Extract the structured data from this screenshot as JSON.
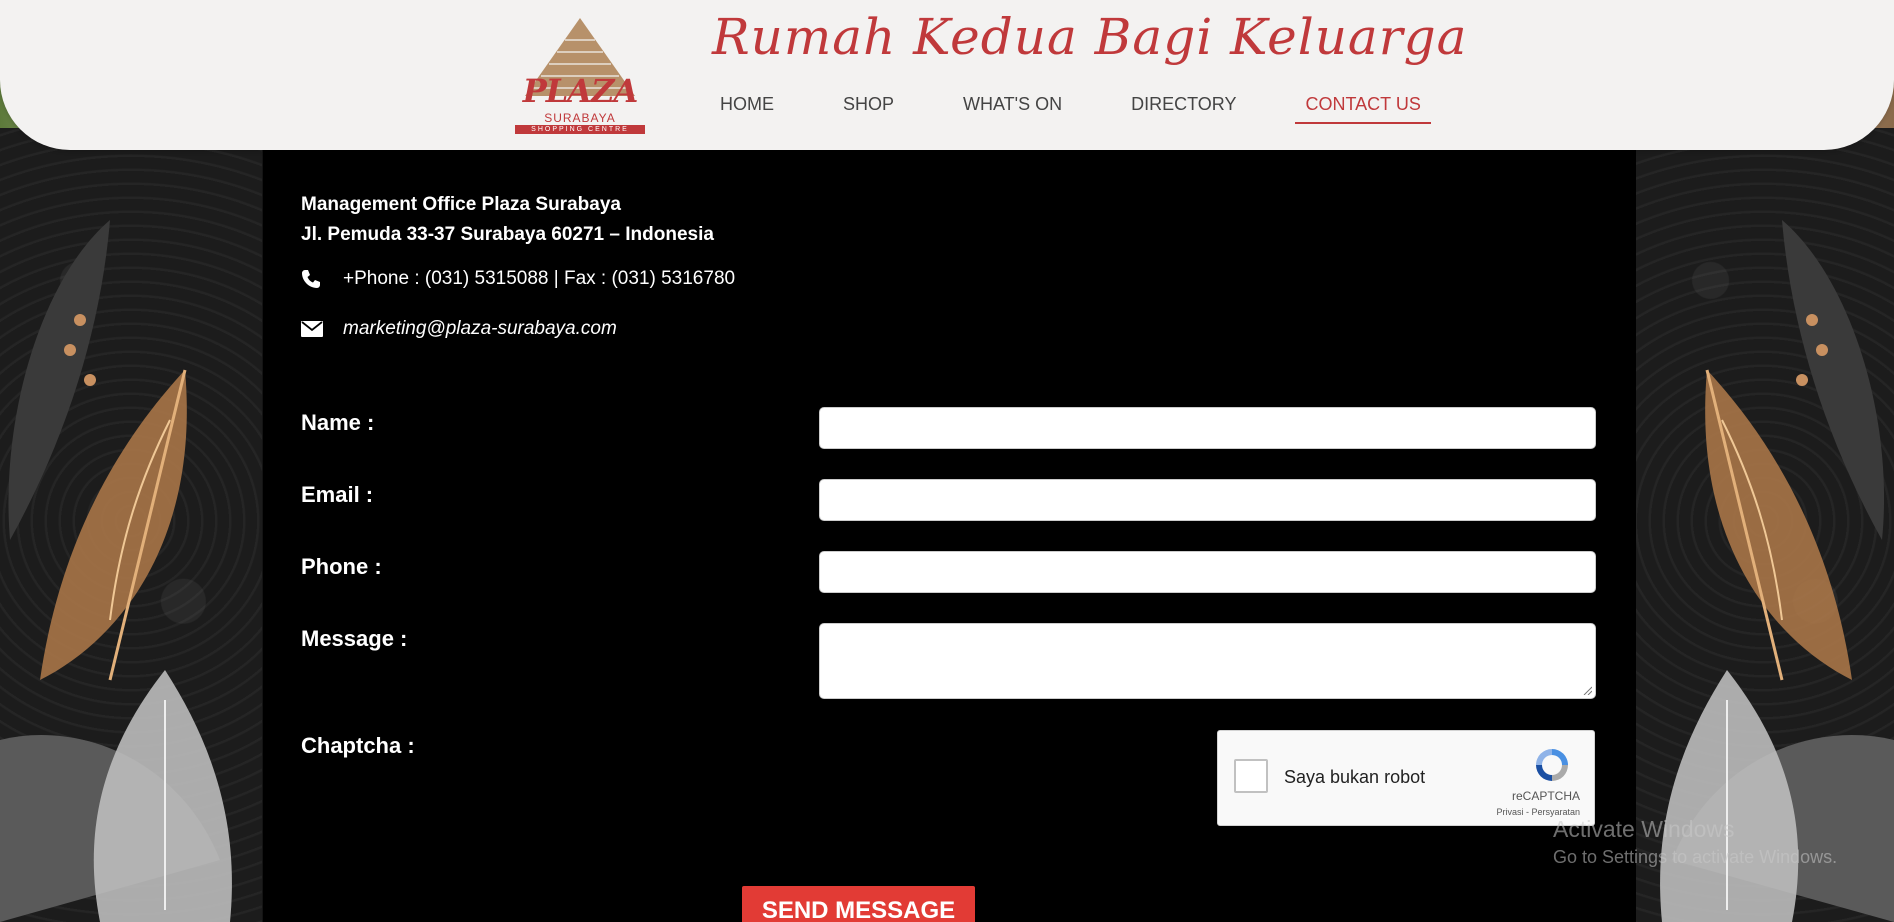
{
  "header": {
    "tagline": "Rumah Kedua Bagi Keluarga",
    "logo": {
      "main": "PLAZA",
      "sub": "SURABAYA",
      "band": "SHOPPING CENTRE"
    },
    "nav": [
      {
        "label": "HOME",
        "active": false
      },
      {
        "label": "SHOP",
        "active": false
      },
      {
        "label": "WHAT'S ON",
        "active": false
      },
      {
        "label": "DIRECTORY",
        "active": false
      },
      {
        "label": "CONTACT US",
        "active": true
      }
    ]
  },
  "contact": {
    "office": "Management Office Plaza Surabaya",
    "address": "Jl. Pemuda 33-37 Surabaya 60271 – Indonesia",
    "phone": "+Phone : (031) 5315088 | Fax : (031) 5316780",
    "email": "marketing@plaza-surabaya.com",
    "phone_icon": "phone-icon",
    "email_icon": "envelope-icon"
  },
  "form": {
    "name_label": "Name :",
    "email_label": "Email :",
    "phone_label": "Phone :",
    "message_label": "Message :",
    "captcha_label": "Chaptcha :",
    "name_value": "",
    "email_value": "",
    "phone_value": "",
    "message_value": "",
    "send_label": "SEND MESSAGE"
  },
  "recaptcha": {
    "label": "Saya bukan robot",
    "brand": "reCAPTCHA",
    "terms": "Privasi - Persyaratan"
  },
  "watermark": {
    "line1": "Activate Windows",
    "line2": "Go to Settings to activate Windows."
  },
  "colors": {
    "accent": "#c0393b",
    "button": "#e23b35",
    "panel": "#000000"
  }
}
